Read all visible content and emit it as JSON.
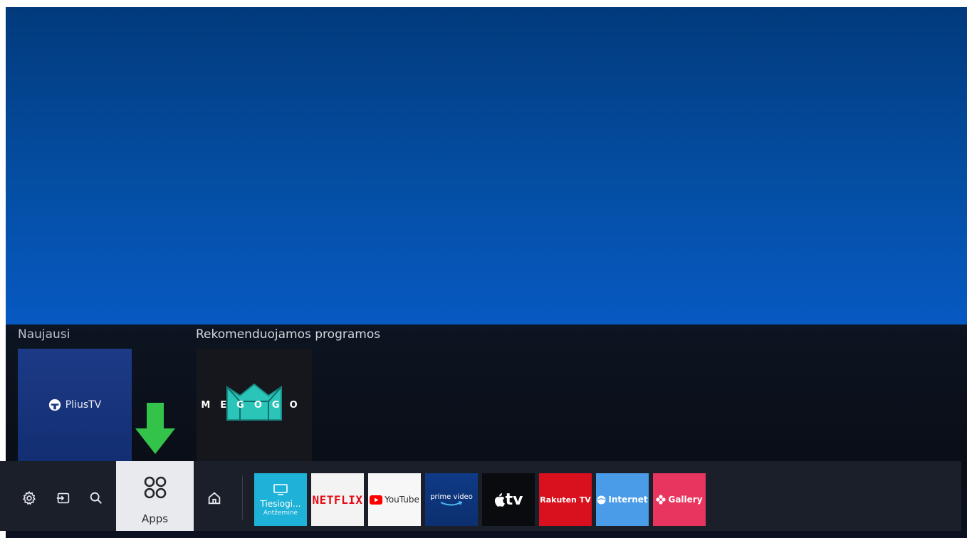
{
  "sections": {
    "recent_title": "Naujausi",
    "recommended_title": "Rekomenduojamos programos"
  },
  "recent": [
    {
      "name": "Plius TV",
      "logo_text": "PliusTV"
    }
  ],
  "recommended": [
    {
      "name": "MEGOGO",
      "logo_text": "MEGOGO"
    }
  ],
  "bar": {
    "settings_icon": "gear-icon",
    "source_icon": "input-source-icon",
    "search_icon": "search-icon",
    "apps_label": "Apps",
    "home_icon": "home-icon"
  },
  "apps": [
    {
      "name": "Tiesiogi...",
      "sub": "Antžeminė",
      "color": "#1fb2d8"
    },
    {
      "name": "NETFLIX",
      "color": "#e50914"
    },
    {
      "name": "YouTube",
      "color": "#ff0000"
    },
    {
      "name": "prime video",
      "color": "#0f3a86"
    },
    {
      "name": "tv",
      "color": "#0a0b0e"
    },
    {
      "name": "Rakuten TV",
      "color": "#d9101e"
    },
    {
      "name": "Internet",
      "color": "#4a9be8"
    },
    {
      "name": "Gallery",
      "color": "#e8355f"
    }
  ],
  "colors": {
    "highlight_arrow": "#33c24a",
    "background_top": "#023a7c",
    "background_bottom": "#0759c2"
  }
}
